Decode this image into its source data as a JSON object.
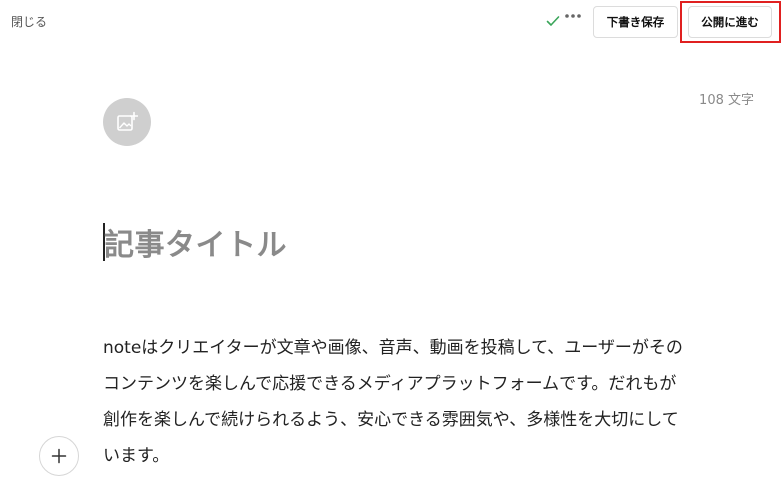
{
  "header": {
    "close_label": "閉じる",
    "draft_save_label": "下書き保存",
    "publish_label": "公開に進む"
  },
  "editor": {
    "char_count": "108 文字",
    "title_placeholder": "記事タイトル",
    "body_lines": [
      "noteはクリエイターが文章や画像、音声、動画を投稿して、ユーザーがその",
      "コンテンツを楽しんで応援できるメディアプラットフォームです。だれもが",
      "創作を楽しんで続けられるよう、安心できる雰囲気や、多様性を大切にして",
      "います。"
    ]
  },
  "icons": {
    "saved": "check-icon",
    "more": "more-dots-icon",
    "image": "image-add-icon",
    "add_block": "plus-icon"
  },
  "colors": {
    "saved_check": "#3aa55a",
    "highlight": "#e02020",
    "placeholder": "#8a8a8a"
  }
}
